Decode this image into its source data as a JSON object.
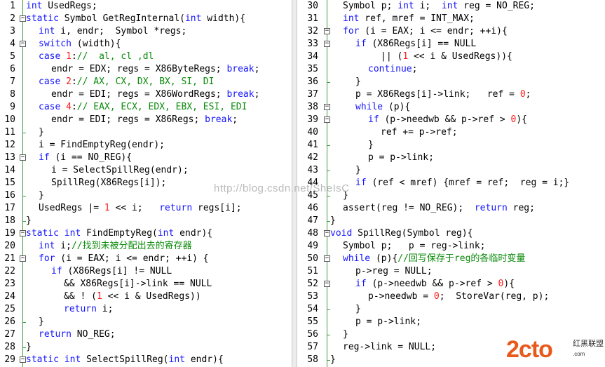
{
  "left_pane": {
    "lines": [
      {
        "n": "1",
        "fold": "",
        "indent": 0,
        "tokens": [
          [
            "kw",
            "int"
          ],
          [
            "tx",
            " UsedRegs;"
          ]
        ]
      },
      {
        "n": "2",
        "fold": "-",
        "indent": 0,
        "tokens": [
          [
            "kw",
            "static"
          ],
          [
            "tx",
            " Symbol GetRegInternal("
          ],
          [
            "kw",
            "int"
          ],
          [
            "tx",
            " width){"
          ]
        ]
      },
      {
        "n": "3",
        "fold": "",
        "indent": 1,
        "tokens": [
          [
            "kw",
            "int"
          ],
          [
            "tx",
            " i, endr;  Symbol *regs;"
          ]
        ]
      },
      {
        "n": "4",
        "fold": "-",
        "indent": 1,
        "tokens": [
          [
            "kw",
            "switch"
          ],
          [
            "tx",
            " (width){"
          ]
        ]
      },
      {
        "n": "5",
        "fold": "",
        "indent": 1,
        "tokens": [
          [
            "kw",
            "case"
          ],
          [
            "tx",
            " "
          ],
          [
            "nm",
            "1"
          ],
          [
            "tx",
            ":"
          ],
          [
            "cm",
            "//  al, cl ,dl"
          ]
        ]
      },
      {
        "n": "6",
        "fold": "",
        "indent": 2,
        "tokens": [
          [
            "tx",
            "endr = EDX; regs = X86ByteRegs; "
          ],
          [
            "kw",
            "break"
          ],
          [
            "tx",
            ";"
          ]
        ]
      },
      {
        "n": "7",
        "fold": "",
        "indent": 1,
        "tokens": [
          [
            "kw",
            "case"
          ],
          [
            "tx",
            " "
          ],
          [
            "nm",
            "2"
          ],
          [
            "tx",
            ":"
          ],
          [
            "cm",
            "// AX, CX, DX, BX, SI, DI"
          ]
        ]
      },
      {
        "n": "8",
        "fold": "",
        "indent": 2,
        "tokens": [
          [
            "tx",
            "endr = EDI; regs = X86WordRegs; "
          ],
          [
            "kw",
            "break"
          ],
          [
            "tx",
            ";"
          ]
        ]
      },
      {
        "n": "9",
        "fold": "",
        "indent": 1,
        "tokens": [
          [
            "kw",
            "case"
          ],
          [
            "tx",
            " "
          ],
          [
            "nm",
            "4"
          ],
          [
            "tx",
            ":"
          ],
          [
            "cm",
            "// EAX, ECX, EDX, EBX, ESI, EDI"
          ]
        ]
      },
      {
        "n": "10",
        "fold": "",
        "indent": 2,
        "tokens": [
          [
            "tx",
            "endr = EDI; regs = X86Regs; "
          ],
          [
            "kw",
            "break"
          ],
          [
            "tx",
            ";"
          ]
        ]
      },
      {
        "n": "11",
        "fold": "end",
        "indent": 1,
        "tokens": [
          [
            "tx",
            "}"
          ]
        ]
      },
      {
        "n": "12",
        "fold": "",
        "indent": 1,
        "tokens": [
          [
            "tx",
            "i = FindEmptyReg(endr);"
          ]
        ]
      },
      {
        "n": "13",
        "fold": "-",
        "indent": 1,
        "tokens": [
          [
            "kw",
            "if"
          ],
          [
            "tx",
            " (i == NO_REG){"
          ]
        ]
      },
      {
        "n": "14",
        "fold": "",
        "indent": 2,
        "tokens": [
          [
            "tx",
            "i = SelectSpillReg(endr);"
          ]
        ]
      },
      {
        "n": "15",
        "fold": "",
        "indent": 2,
        "tokens": [
          [
            "tx",
            "SpillReg(X86Regs[i]);"
          ]
        ]
      },
      {
        "n": "16",
        "fold": "end",
        "indent": 1,
        "tokens": [
          [
            "tx",
            "}"
          ]
        ]
      },
      {
        "n": "17",
        "fold": "",
        "indent": 1,
        "tokens": [
          [
            "tx",
            "UsedRegs |= "
          ],
          [
            "nm",
            "1"
          ],
          [
            "tx",
            " << i;   "
          ],
          [
            "kw",
            "return"
          ],
          [
            "tx",
            " regs[i];"
          ]
        ]
      },
      {
        "n": "18",
        "fold": "end",
        "indent": 0,
        "tokens": [
          [
            "tx",
            "}"
          ]
        ]
      },
      {
        "n": "19",
        "fold": "-",
        "indent": 0,
        "tokens": [
          [
            "kw",
            "static"
          ],
          [
            "tx",
            " "
          ],
          [
            "kw",
            "int"
          ],
          [
            "tx",
            " FindEmptyReg("
          ],
          [
            "kw",
            "int"
          ],
          [
            "tx",
            " endr){"
          ]
        ]
      },
      {
        "n": "20",
        "fold": "",
        "indent": 1,
        "tokens": [
          [
            "kw",
            "int"
          ],
          [
            "tx",
            " i;"
          ],
          [
            "cm",
            "//找到未被分配出去的寄存器"
          ]
        ]
      },
      {
        "n": "21",
        "fold": "-",
        "indent": 1,
        "tokens": [
          [
            "kw",
            "for"
          ],
          [
            "tx",
            " (i = EAX; i <= endr; ++i) {"
          ]
        ]
      },
      {
        "n": "22",
        "fold": "",
        "indent": 2,
        "tokens": [
          [
            "kw",
            "if"
          ],
          [
            "tx",
            " (X86Regs[i] != NULL"
          ]
        ]
      },
      {
        "n": "23",
        "fold": "",
        "indent": 3,
        "tokens": [
          [
            "tx",
            "&& X86Regs[i]->link == NULL"
          ]
        ]
      },
      {
        "n": "24",
        "fold": "",
        "indent": 3,
        "tokens": [
          [
            "tx",
            "&& ! ("
          ],
          [
            "nm",
            "1"
          ],
          [
            "tx",
            " << i & UsedRegs))"
          ]
        ]
      },
      {
        "n": "25",
        "fold": "",
        "indent": 3,
        "tokens": [
          [
            "kw",
            "return"
          ],
          [
            "tx",
            " i;"
          ]
        ]
      },
      {
        "n": "26",
        "fold": "end",
        "indent": 1,
        "tokens": [
          [
            "tx",
            "}"
          ]
        ]
      },
      {
        "n": "27",
        "fold": "",
        "indent": 1,
        "tokens": [
          [
            "kw",
            "return"
          ],
          [
            "tx",
            " NO_REG;"
          ]
        ]
      },
      {
        "n": "28",
        "fold": "end",
        "indent": 0,
        "tokens": [
          [
            "tx",
            "}"
          ]
        ]
      },
      {
        "n": "29",
        "fold": "-",
        "indent": 0,
        "tokens": [
          [
            "kw",
            "static"
          ],
          [
            "tx",
            " "
          ],
          [
            "kw",
            "int"
          ],
          [
            "tx",
            " SelectSpillReg("
          ],
          [
            "kw",
            "int"
          ],
          [
            "tx",
            " endr){"
          ]
        ]
      }
    ]
  },
  "right_pane": {
    "lines": [
      {
        "n": "30",
        "fold": "",
        "indent": 1,
        "tokens": [
          [
            "tx",
            "Symbol p; "
          ],
          [
            "kw",
            "int"
          ],
          [
            "tx",
            " i;  "
          ],
          [
            "kw",
            "int"
          ],
          [
            "tx",
            " reg = NO_REG;"
          ]
        ]
      },
      {
        "n": "31",
        "fold": "",
        "indent": 1,
        "tokens": [
          [
            "kw",
            "int"
          ],
          [
            "tx",
            " ref, mref = INT_MAX;"
          ]
        ]
      },
      {
        "n": "32",
        "fold": "-",
        "indent": 1,
        "tokens": [
          [
            "kw",
            "for"
          ],
          [
            "tx",
            " (i = EAX; i <= endr; ++i){"
          ]
        ]
      },
      {
        "n": "33",
        "fold": "-",
        "indent": 2,
        "tokens": [
          [
            "kw",
            "if"
          ],
          [
            "tx",
            " (X86Regs[i] == NULL"
          ]
        ]
      },
      {
        "n": "34",
        "fold": "",
        "indent": 4,
        "tokens": [
          [
            "tx",
            "|| ("
          ],
          [
            "nm",
            "1"
          ],
          [
            "tx",
            " << i & UsedRegs)){"
          ]
        ]
      },
      {
        "n": "35",
        "fold": "",
        "indent": 3,
        "tokens": [
          [
            "kw",
            "continue"
          ],
          [
            "tx",
            ";"
          ]
        ]
      },
      {
        "n": "36",
        "fold": "end",
        "indent": 2,
        "tokens": [
          [
            "tx",
            "}"
          ]
        ]
      },
      {
        "n": "37",
        "fold": "",
        "indent": 2,
        "tokens": [
          [
            "tx",
            "p = X86Regs[i]->link;   ref = "
          ],
          [
            "nm",
            "0"
          ],
          [
            "tx",
            ";"
          ]
        ]
      },
      {
        "n": "38",
        "fold": "-",
        "indent": 2,
        "tokens": [
          [
            "kw",
            "while"
          ],
          [
            "tx",
            " (p){"
          ]
        ]
      },
      {
        "n": "39",
        "fold": "-",
        "indent": 3,
        "tokens": [
          [
            "kw",
            "if"
          ],
          [
            "tx",
            " (p->needwb && p->ref > "
          ],
          [
            "nm",
            "0"
          ],
          [
            "tx",
            "){"
          ]
        ]
      },
      {
        "n": "40",
        "fold": "",
        "indent": 4,
        "tokens": [
          [
            "tx",
            "ref += p->ref;"
          ]
        ]
      },
      {
        "n": "41",
        "fold": "end",
        "indent": 3,
        "tokens": [
          [
            "tx",
            "}"
          ]
        ]
      },
      {
        "n": "42",
        "fold": "",
        "indent": 3,
        "tokens": [
          [
            "tx",
            "p = p->link;"
          ]
        ]
      },
      {
        "n": "43",
        "fold": "end",
        "indent": 2,
        "tokens": [
          [
            "tx",
            "}"
          ]
        ]
      },
      {
        "n": "44",
        "fold": "",
        "indent": 2,
        "tokens": [
          [
            "kw",
            "if"
          ],
          [
            "tx",
            " (ref < mref) {mref = ref;  reg = i;}"
          ]
        ]
      },
      {
        "n": "45",
        "fold": "end",
        "indent": 1,
        "tokens": [
          [
            "tx",
            "}"
          ]
        ]
      },
      {
        "n": "46",
        "fold": "",
        "indent": 1,
        "tokens": [
          [
            "tx",
            "assert(reg != NO_REG);  "
          ],
          [
            "kw",
            "return"
          ],
          [
            "tx",
            " reg;"
          ]
        ]
      },
      {
        "n": "47",
        "fold": "end",
        "indent": 0,
        "tokens": [
          [
            "tx",
            "}"
          ]
        ]
      },
      {
        "n": "48",
        "fold": "-",
        "indent": 0,
        "tokens": [
          [
            "kw",
            "void"
          ],
          [
            "tx",
            " SpillReg(Symbol reg){"
          ]
        ]
      },
      {
        "n": "49",
        "fold": "",
        "indent": 1,
        "tokens": [
          [
            "tx",
            "Symbol p;   p = reg->link;"
          ]
        ]
      },
      {
        "n": "50",
        "fold": "-",
        "indent": 1,
        "tokens": [
          [
            "kw",
            "while"
          ],
          [
            "tx",
            " (p){"
          ],
          [
            "cm",
            "//回写保存于reg的各临时变量"
          ]
        ]
      },
      {
        "n": "51",
        "fold": "",
        "indent": 2,
        "tokens": [
          [
            "tx",
            "p->reg = NULL;"
          ]
        ]
      },
      {
        "n": "52",
        "fold": "-",
        "indent": 2,
        "tokens": [
          [
            "kw",
            "if"
          ],
          [
            "tx",
            " (p->needwb && p->ref > "
          ],
          [
            "nm",
            "0"
          ],
          [
            "tx",
            "){"
          ]
        ]
      },
      {
        "n": "53",
        "fold": "",
        "indent": 3,
        "tokens": [
          [
            "tx",
            "p->needwb = "
          ],
          [
            "nm",
            "0"
          ],
          [
            "tx",
            ";  StoreVar(reg, p);"
          ]
        ]
      },
      {
        "n": "54",
        "fold": "end",
        "indent": 2,
        "tokens": [
          [
            "tx",
            "}"
          ]
        ]
      },
      {
        "n": "55",
        "fold": "",
        "indent": 2,
        "tokens": [
          [
            "tx",
            "p = p->link;"
          ]
        ]
      },
      {
        "n": "56",
        "fold": "end",
        "indent": 1,
        "tokens": [
          [
            "tx",
            "}"
          ]
        ]
      },
      {
        "n": "57",
        "fold": "",
        "indent": 1,
        "tokens": [
          [
            "tx",
            "reg->link = NULL;"
          ]
        ]
      },
      {
        "n": "58",
        "fold": "end",
        "indent": 0,
        "tokens": [
          [
            "tx",
            "}"
          ]
        ]
      }
    ]
  },
  "watermark": "http://blog.csdn.net/SheIsC",
  "logo": {
    "main": "2cto",
    "sub": "红黑联盟",
    "sub2": ".com"
  },
  "colors": {
    "keyword": "#1515ff",
    "comment": "#0a8a0a",
    "number": "#ff1a1a",
    "fold_line": "#3e9b3e"
  }
}
